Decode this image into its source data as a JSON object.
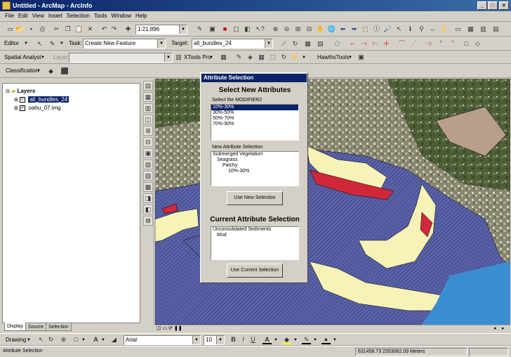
{
  "window": {
    "title": "Untitled - ArcMap - ArcInfo",
    "min": "_",
    "max": "□",
    "close": "×"
  },
  "menu": [
    "File",
    "Edit",
    "View",
    "Insert",
    "Selection",
    "Tools",
    "Window",
    "Help"
  ],
  "toolbar1": {
    "scale": "1:21,896"
  },
  "toolbar2": {
    "editor": "Editor",
    "task_label": "Task:",
    "task_value": "Create New Feature",
    "target_label": "Target:",
    "target_value": "all_bundles_24"
  },
  "toolbar3": {
    "spatial_analyst": "Spatial Analyst",
    "layer_label": "Layer:",
    "xtools": "XTools Pro",
    "hawths": "HawthsTools"
  },
  "toolbar4": {
    "classification": "Classification"
  },
  "toc": {
    "root": "Layers",
    "layers": [
      "all_bundles_24",
      "oahu_07.img"
    ]
  },
  "toc_tabs": [
    "Display",
    "Source",
    "Selection"
  ],
  "dialog": {
    "title": "Attribute Selection",
    "heading1": "Select New Attributes",
    "select_label": "Select the MODIFIER2",
    "modifier_options": [
      "10%-30%",
      "30%-50%",
      "50%-70%",
      "70%-90%"
    ],
    "new_sel_label": "New Attribute Selection",
    "new_sel_items": [
      "Submerged Vegetation",
      "Seagrass",
      "Patchy",
      "10%-30%"
    ],
    "use_new_button": "Use New Selection",
    "heading2": "Current Attribute Selection",
    "current_items": [
      "Unconsolidated Sediments",
      "Mud"
    ],
    "use_current_button": "Use Current Selection"
  },
  "drawing": {
    "drawing_label": "Drawing",
    "font": "Arial",
    "size": "10",
    "bold": "B",
    "italic": "I",
    "underline": "U"
  },
  "status": {
    "left": "Attribute Selection",
    "coords": "631458.73  2353062.09 Meters"
  },
  "colors": {
    "title_start": "#0a246a",
    "title_end": "#3a6ea5",
    "water": "#5a63a8",
    "sand": "#f7f2b8",
    "reef": "#d0283a",
    "ocean": "#3a8ed0"
  }
}
